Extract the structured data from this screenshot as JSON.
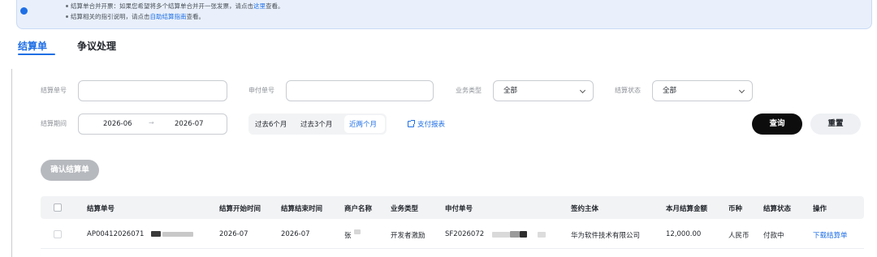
{
  "notice": {
    "line1_text": "结算单合并开票：如果您希望将多个结算单合并开一张发票，请点击",
    "line1_link": "这里",
    "line1_suffix": "查看。",
    "line2_text": "结算相关的指引说明，请点击",
    "line2_link": "自助结算指南",
    "line2_suffix": "查看。"
  },
  "tabs": [
    {
      "label": "结算单",
      "active": true
    },
    {
      "label": "争议处理",
      "active": false
    }
  ],
  "filters": {
    "settlement_no_label": "结算单号",
    "settlement_no_value": "",
    "payment_no_label": "申付单号",
    "payment_no_value": "",
    "business_type_label": "业务类型",
    "business_type_value": "全部",
    "status_label": "结算状态",
    "status_value": "全部",
    "period_label": "结算期间",
    "period_start": "2026-06",
    "period_end": "2026-07",
    "period_separator": "→",
    "quick_ranges": [
      "过去6个月",
      "过去3个月",
      "近两个月"
    ],
    "payment_report_link": "支付报表",
    "query_button": "查询",
    "reset_button": "重置"
  },
  "confirm_button": "确认结算单",
  "table": {
    "columns": [
      "结算单号",
      "结算开始时间",
      "结算结束时间",
      "商户名称",
      "业务类型",
      "申付单号",
      "签约主体",
      "本月结算金额",
      "币种",
      "结算状态",
      "操作"
    ],
    "rows": [
      {
        "settlement_no": "AP00412026071",
        "start": "2026-07",
        "end": "2026-07",
        "merchant": "张",
        "business_type": "开发者激励",
        "payment_no": "SF2026072",
        "entity": "华为软件技术有限公司",
        "amount": "12,000.00",
        "currency": "人民币",
        "status": "付款中",
        "action": "下载结算单"
      }
    ]
  },
  "colors": {
    "accent": "#1f6fe5",
    "primary_button": "#0d0d0d",
    "notice_bg": "#e9f0fb"
  }
}
